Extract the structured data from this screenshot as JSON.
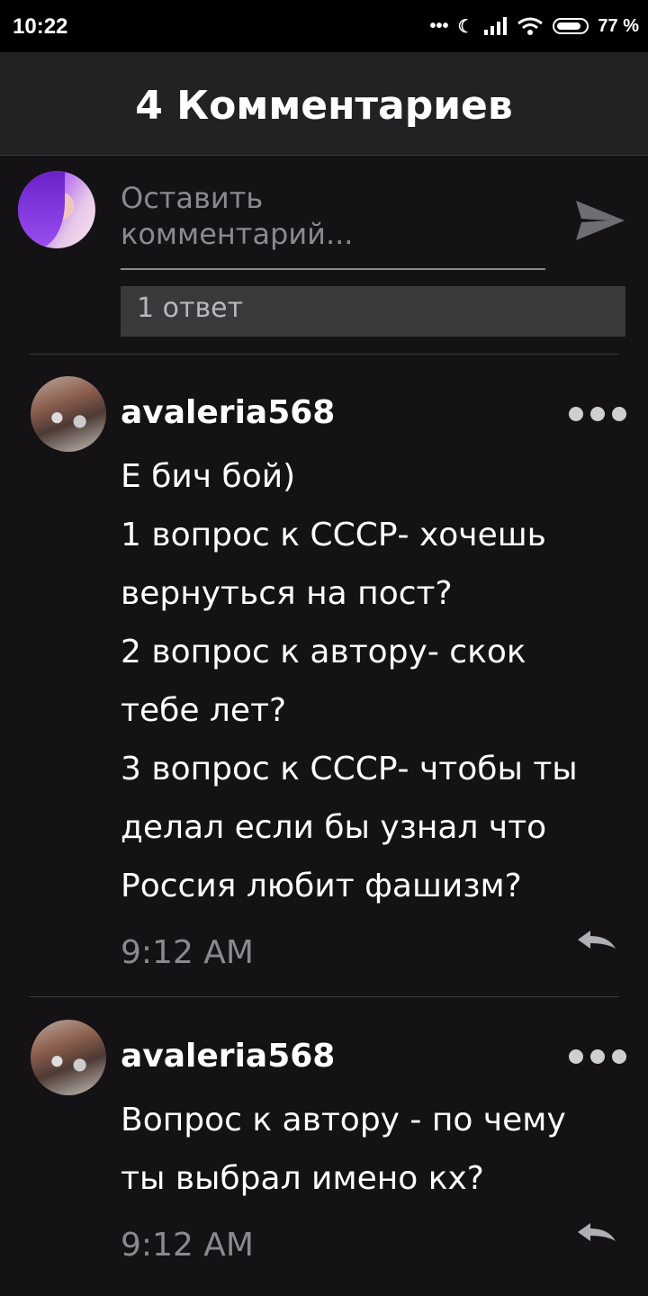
{
  "status_bar": {
    "time": "10:22",
    "battery": "77 %",
    "battery_level": 0.77,
    "icons": [
      "dots-icon",
      "moon-icon",
      "signal-icon",
      "wifi-icon",
      "battery-icon"
    ]
  },
  "header": {
    "title": "4 Комментариев"
  },
  "composer": {
    "placeholder_line1": "Оставить",
    "placeholder_line2": "комментарий...",
    "send_icon": "send-icon",
    "reply_bar": "1 ответ"
  },
  "comments": [
    {
      "username": "avaleria568",
      "lines": [
        "Е бич бой)",
        "1 вопрос к СССР- хочешь",
        "вернуться на пост?",
        "2 вопрос к автору- скок",
        "тебе лет?",
        "3 вопрос к СССР- чтобы ты",
        "делал если бы узнал что",
        "Россия любит фашизм?"
      ],
      "time": "9:12 AM"
    },
    {
      "username": "avaleria568",
      "lines": [
        "Вопрос к автору - по чему",
        "ты выбрал имено кх?"
      ],
      "time": "9:12 AM"
    }
  ],
  "colors": {
    "background": "#141215",
    "header": "#222123",
    "text": "#ffffff",
    "muted": "#8a8a8e"
  }
}
